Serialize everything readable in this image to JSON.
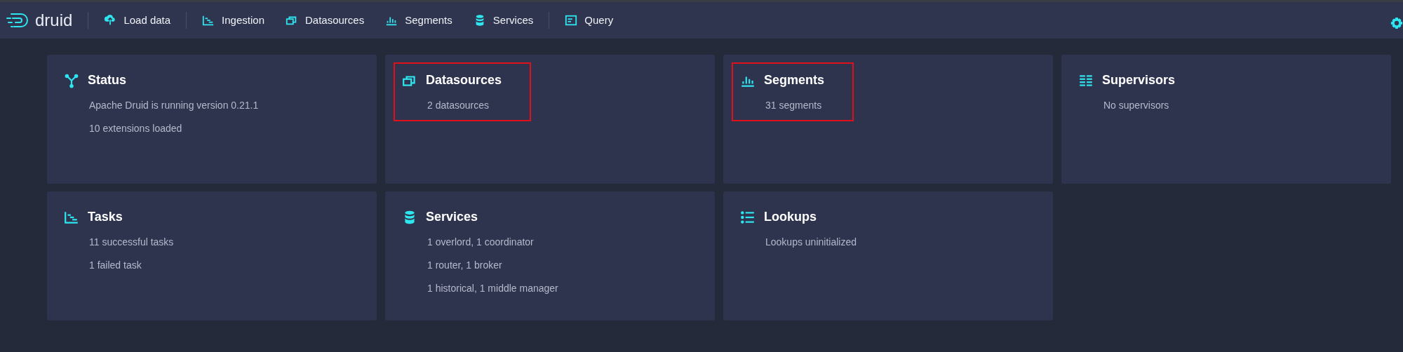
{
  "navbar": {
    "logo": "druid",
    "groups": [
      {
        "items": [
          "Load data"
        ]
      },
      {
        "items": [
          "Ingestion",
          "Datasources",
          "Segments",
          "Services"
        ]
      },
      {
        "items": [
          "Query"
        ]
      }
    ]
  },
  "cards": [
    {
      "title": "Status",
      "lines": [
        "Apache Druid is running version 0.21.1",
        "10 extensions loaded"
      ],
      "highlighted": false
    },
    {
      "title": "Datasources",
      "lines": [
        "2 datasources"
      ],
      "highlighted": true
    },
    {
      "title": "Segments",
      "lines": [
        "31 segments"
      ],
      "highlighted": true
    },
    {
      "title": "Supervisors",
      "lines": [
        "No supervisors"
      ],
      "highlighted": false
    },
    {
      "title": "Tasks",
      "lines": [
        "11 successful tasks",
        "1 failed task"
      ],
      "highlighted": false
    },
    {
      "title": "Services",
      "lines": [
        "1 overlord, 1 coordinator",
        "1 router, 1 broker",
        "1 historical, 1 middle manager"
      ],
      "highlighted": false
    },
    {
      "title": "Lookups",
      "lines": [
        "Lookups uninitialized"
      ],
      "highlighted": false
    }
  ]
}
